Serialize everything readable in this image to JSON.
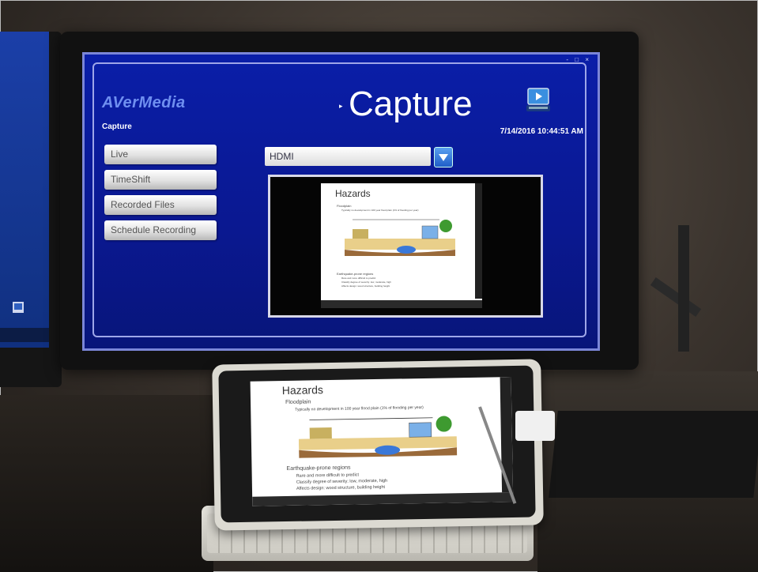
{
  "app": {
    "brand": "AVerMedia",
    "section": "Capture",
    "title": "Capture",
    "datetime": "7/14/2016 10:44:51 AM",
    "window_controls": "- □ ×"
  },
  "nav": {
    "items": [
      {
        "label": "Live"
      },
      {
        "label": "TimeShift"
      },
      {
        "label": "Recorded Files"
      },
      {
        "label": "Schedule Recording"
      }
    ]
  },
  "source": {
    "selected": "HDMI"
  },
  "slide": {
    "title": "Hazards",
    "bullets": [
      "Floodplain",
      "Typically no development in 100 year flood plain (1% of flooding per year)",
      "Earthquake-prone regions",
      "Rare and more difficult to predict",
      "Classify degree of severity: low, moderate, high",
      "Affects design: wood structure, building height"
    ]
  },
  "colors": {
    "app_background": "#0a1ea8",
    "brand": "#6f8ff0",
    "dropdown_accent": "#1f5ec8"
  }
}
